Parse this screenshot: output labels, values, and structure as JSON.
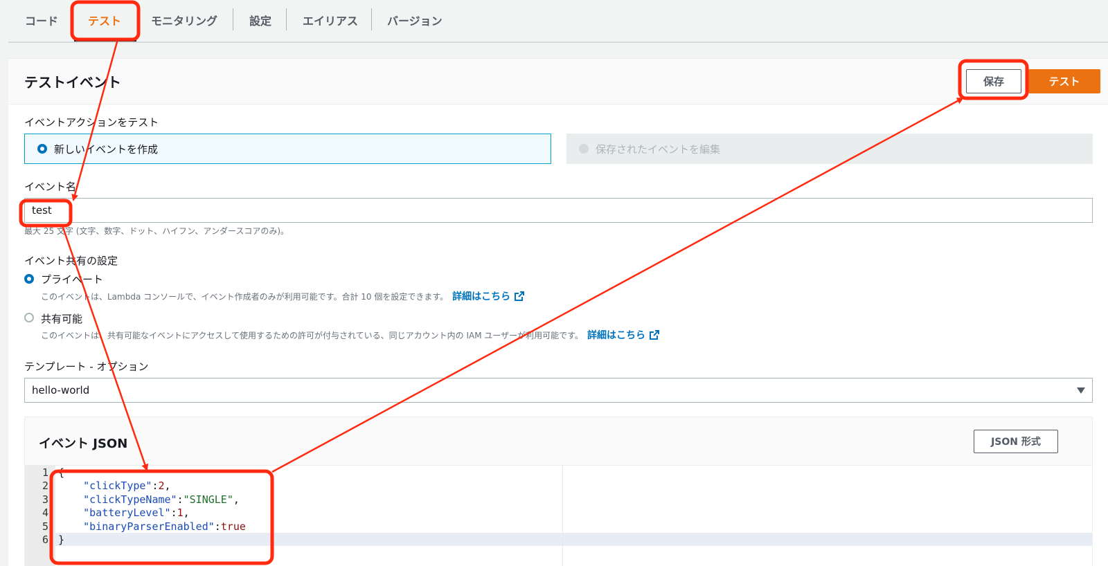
{
  "tabs": [
    {
      "label": "コード"
    },
    {
      "label": "テスト",
      "active": true
    },
    {
      "label": "モニタリング"
    },
    {
      "label": "設定"
    },
    {
      "label": "エイリアス"
    },
    {
      "label": "バージョン"
    }
  ],
  "panel": {
    "title": "テストイベント",
    "save_label": "保存",
    "test_label": "テスト"
  },
  "event_action": {
    "label": "イベントアクションをテスト",
    "new_option": "新しいイベントを作成",
    "edit_option": "保存されたイベントを編集"
  },
  "event_name": {
    "label": "イベント名",
    "value": "test",
    "hint": "最大 25 文字 (文字、数字、ドット、ハイフン、アンダースコアのみ)。"
  },
  "sharing": {
    "label": "イベント共有の設定",
    "private_label": "プライベート",
    "private_desc": "このイベントは、Lambda コンソールで、イベント作成者のみが利用可能です。合計 10 個を設定できます。",
    "shareable_label": "共有可能",
    "shareable_desc": "このイベントは、共有可能なイベントにアクセスして使用するための許可が付与されている、同じアカウント内の IAM ユーザーが利用可能です。",
    "learn_more": "詳細はこちら"
  },
  "template": {
    "label": "テンプレート - オプション",
    "value": "hello-world"
  },
  "event_json": {
    "title": "イベント JSON",
    "format_label": "JSON 形式",
    "line_numbers": [
      "1",
      "2",
      "3",
      "4",
      "5",
      "6"
    ],
    "open_brace": "{",
    "close_brace": "}",
    "entries": [
      {
        "key": "\"clickType\"",
        "sep": ":",
        "value": "2",
        "trail": ","
      },
      {
        "key": "\"clickTypeName\"",
        "sep": ":",
        "value": "\"SINGLE\"",
        "trail": ","
      },
      {
        "key": "\"batteryLevel\"",
        "sep": ":",
        "value": "1",
        "trail": ","
      },
      {
        "key": "\"binaryParserEnabled\"",
        "sep": ":",
        "value": "true",
        "trail": ""
      }
    ]
  },
  "colors": {
    "accent": "#ec7211",
    "link": "#0073bb",
    "annotation": "#ff2a10"
  }
}
